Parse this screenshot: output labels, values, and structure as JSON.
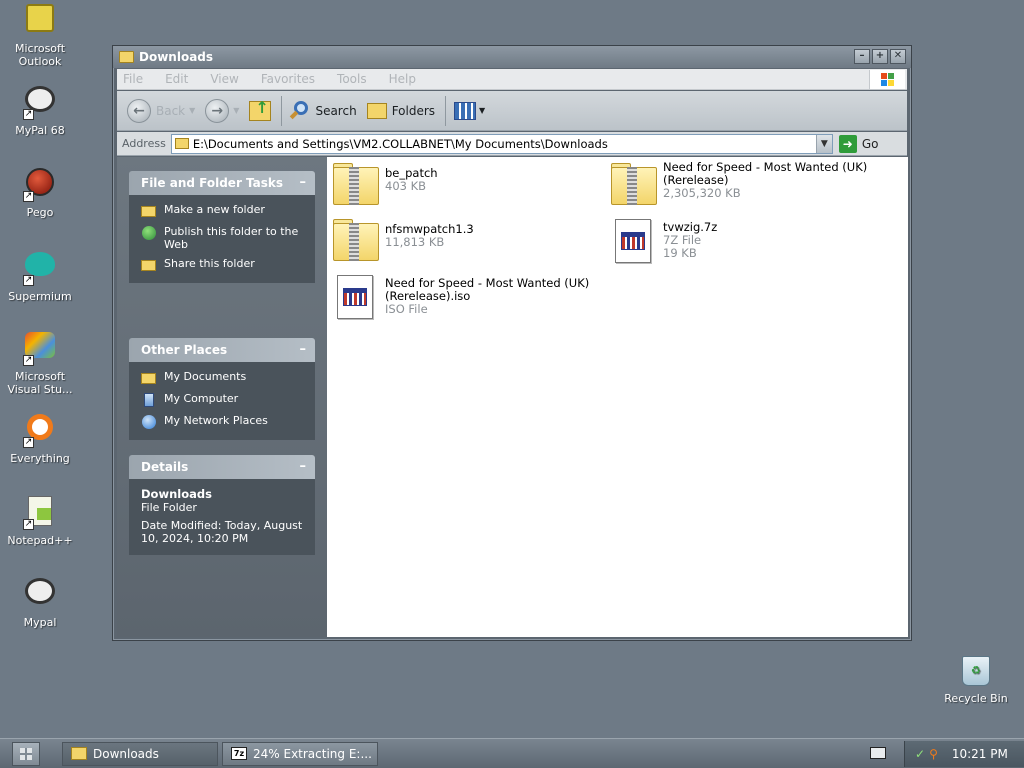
{
  "desktop": {
    "icons": [
      {
        "label": "Microsoft Outlook",
        "icon": "outlook-icon"
      },
      {
        "label": "MyPal 68",
        "icon": "mypal-icon"
      },
      {
        "label": "Pego",
        "icon": "pego-icon"
      },
      {
        "label": "Supermium",
        "icon": "supermium-icon"
      },
      {
        "label": "Microsoft Visual Stu...",
        "icon": "visual-studio-icon"
      },
      {
        "label": "Everything",
        "icon": "everything-icon"
      },
      {
        "label": "Notepad++",
        "icon": "notepadpp-icon"
      },
      {
        "label": "Mypal",
        "icon": "mypal-icon"
      }
    ],
    "recycle_bin": "Recycle Bin"
  },
  "window": {
    "title": "Downloads",
    "menu": [
      "File",
      "Edit",
      "View",
      "Favorites",
      "Tools",
      "Help"
    ],
    "toolbar": {
      "back": "Back",
      "search": "Search",
      "folders": "Folders"
    },
    "address": {
      "label": "Address",
      "value": "E:\\Documents and Settings\\VM2.COLLABNET\\My Documents\\Downloads",
      "go": "Go"
    }
  },
  "sidebar": {
    "tasks": {
      "title": "File and Folder Tasks",
      "items": [
        "Make a new folder",
        "Publish this folder to the Web",
        "Share this folder"
      ]
    },
    "places": {
      "title": "Other Places",
      "items": [
        "My Documents",
        "My Computer",
        "My Network Places"
      ]
    },
    "details": {
      "title": "Details",
      "name": "Downloads",
      "type": "File Folder",
      "modified": "Date Modified: Today, August 10, 2024, 10:20 PM"
    }
  },
  "files": [
    {
      "name": "be_patch",
      "meta": "403 KB",
      "kind": "zip"
    },
    {
      "name": "Need for Speed - Most Wanted (UK) (Rerelease)",
      "meta": "2,305,320 KB",
      "kind": "zip"
    },
    {
      "name": "nfsmwpatch1.3",
      "meta": "11,813 KB",
      "kind": "zip"
    },
    {
      "name": "tvwzig.7z",
      "type": "7Z File",
      "meta": "19 KB",
      "kind": "doc"
    },
    {
      "name": "Need for Speed - Most Wanted (UK) (Rerelease).iso",
      "type": "ISO File",
      "kind": "doc"
    }
  ],
  "taskbar": {
    "tasks": [
      "Downloads",
      "24% Extracting E:..."
    ],
    "clock": "10:21 PM"
  }
}
